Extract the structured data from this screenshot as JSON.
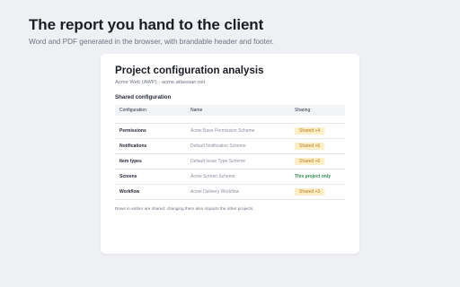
{
  "hero": {
    "title": "The report you hand to the client",
    "subtitle": "Word and PDF generated in the browser, with brandable header and footer."
  },
  "report": {
    "title": "Project configuration analysis",
    "subtitle": "Acme Web (AWP) · acme.atlassian.net",
    "section_heading": "Shared configuration",
    "columns": {
      "configuration": "Configuration",
      "name": "Name",
      "sharing": "Sharing"
    },
    "rows": [
      {
        "configuration": "Permissions",
        "name": "Acme Base Permission Scheme",
        "sharing": "Shared +4",
        "shared": true
      },
      {
        "configuration": "Notifications",
        "name": "Default Notification Scheme",
        "sharing": "Shared +6",
        "shared": true
      },
      {
        "configuration": "Item types",
        "name": "Default Issue Type Scheme",
        "sharing": "Shared +6",
        "shared": true
      },
      {
        "configuration": "Screens",
        "name": "Acme Screen Scheme",
        "sharing": "This project only",
        "shared": false
      },
      {
        "configuration": "Workflow",
        "name": "Acme Delivery Workflow",
        "sharing": "Shared +3",
        "shared": true
      }
    ],
    "footnote": "Rows in amber are shared: changing them also impacts the other projects."
  },
  "colors": {
    "page_background": "#eef0f3",
    "shared_badge_bg": "#fdeec6",
    "shared_badge_text": "#b7791f",
    "exclusive_text": "#2f8f4e"
  }
}
